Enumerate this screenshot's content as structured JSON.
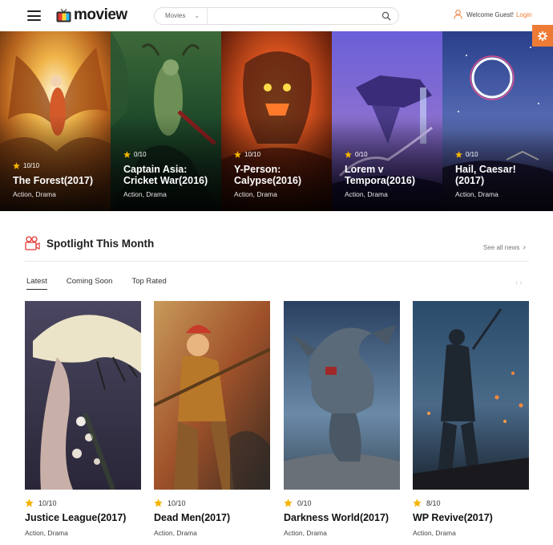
{
  "header": {
    "logo_text": "moview",
    "search": {
      "category": "Movies",
      "placeholder": ""
    },
    "welcome_text": "Welcome Guest!",
    "login_label": "Login"
  },
  "hero": [
    {
      "rating": "10/10",
      "title": "The Forest(2017)",
      "genre": "Action, Drama"
    },
    {
      "rating": "0/10",
      "title": "Captain Asia: Cricket War(2016)",
      "genre": "Action, Drama"
    },
    {
      "rating": "10/10",
      "title": "Y-Person: Calypse(2016)",
      "genre": "Action, Drama"
    },
    {
      "rating": "0/10",
      "title": "Lorem v Tempora(2016)",
      "genre": "Action, Drama"
    },
    {
      "rating": "0/10",
      "title": "Hail, Caesar! (2017)",
      "genre": "Action, Drama"
    }
  ],
  "spotlight": {
    "title": "Spotlight This Month",
    "see_all": "See all news",
    "tabs": [
      "Latest",
      "Coming Soon",
      "Top Rated"
    ],
    "active_tab": "Latest",
    "cards": [
      {
        "rating": "10/10",
        "title": "Justice League(2017)",
        "genre": "Action, Drama"
      },
      {
        "rating": "10/10",
        "title": "Dead Men(2017)",
        "genre": "Action, Drama"
      },
      {
        "rating": "0/10",
        "title": "Darkness World(2017)",
        "genre": "Action, Drama"
      },
      {
        "rating": "8/10",
        "title": "WP Revive(2017)",
        "genre": "Action, Drama"
      }
    ]
  },
  "colors": {
    "accent": "#ee7b35",
    "star": "#f5b400"
  }
}
